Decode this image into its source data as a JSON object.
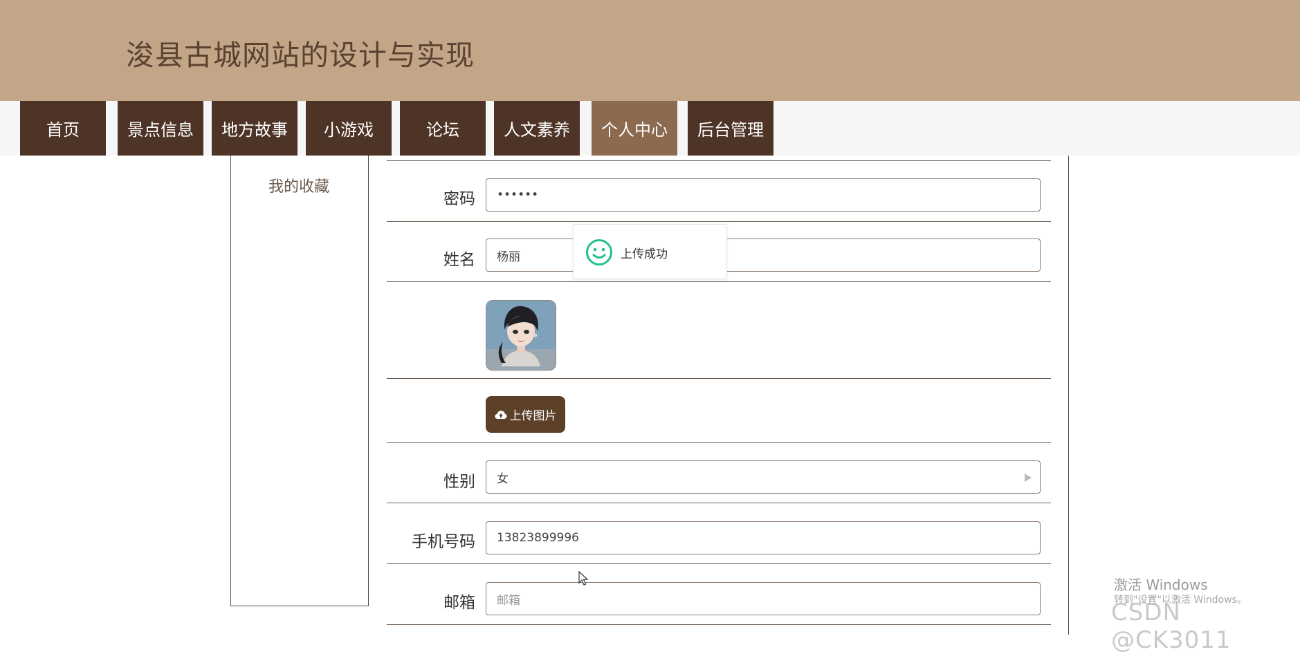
{
  "header": {
    "title": "浚县古城网站的设计与实现"
  },
  "nav": {
    "items": [
      {
        "label": "首页"
      },
      {
        "label": "景点信息"
      },
      {
        "label": "地方故事"
      },
      {
        "label": "小游戏"
      },
      {
        "label": "论坛"
      },
      {
        "label": "人文素养"
      },
      {
        "label": "个人中心",
        "active": true
      },
      {
        "label": "后台管理"
      }
    ]
  },
  "sidebar": {
    "items": [
      {
        "label": "我的收藏"
      }
    ]
  },
  "form": {
    "password": {
      "label": "密码",
      "value": "••••••"
    },
    "name": {
      "label": "姓名",
      "value": "杨丽"
    },
    "upload_button": "上传图片",
    "gender": {
      "label": "性别",
      "value": "女"
    },
    "phone": {
      "label": "手机号码",
      "value": "13823899996"
    },
    "email": {
      "label": "邮箱",
      "placeholder": "邮箱"
    }
  },
  "toast": {
    "message": "上传成功",
    "icon": "smile-icon"
  },
  "watermarks": {
    "windows": "激活 Windows",
    "windows_sub": "转到\"设置\"以激活 Windows。",
    "csdn": "CSDN @CK3011"
  },
  "colors": {
    "header_bg": "#c3a688",
    "nav_bg": "#4e3426",
    "nav_active_bg": "#8b6a4f",
    "button_bg": "#5c4128",
    "toast_icon": "#1fbf8f"
  }
}
